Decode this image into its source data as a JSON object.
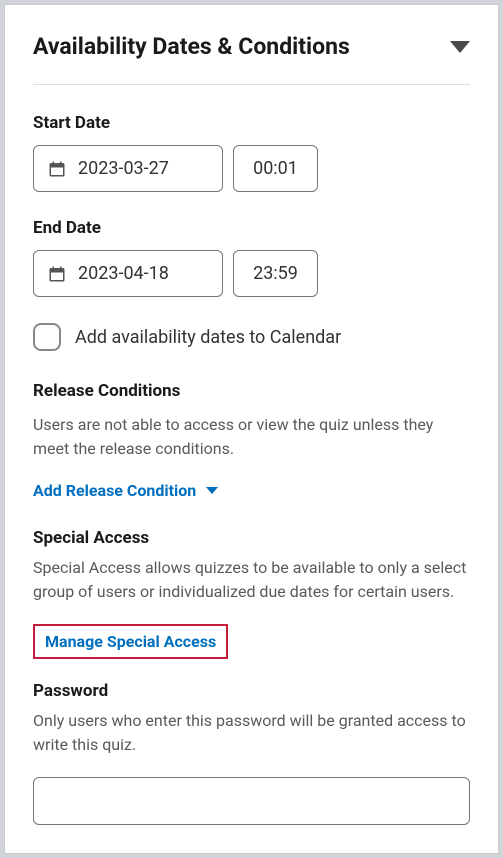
{
  "panel": {
    "title": "Availability Dates & Conditions"
  },
  "startDate": {
    "label": "Start Date",
    "date": "2023-03-27",
    "time": "00:01"
  },
  "endDate": {
    "label": "End Date",
    "date": "2023-04-18",
    "time": "23:59"
  },
  "calendarCheckbox": {
    "label": "Add availability dates to Calendar",
    "checked": false
  },
  "releaseConditions": {
    "heading": "Release Conditions",
    "description": "Users are not able to access or view the quiz unless they meet the release conditions.",
    "action": "Add Release Condition"
  },
  "specialAccess": {
    "heading": "Special Access",
    "description": "Special Access allows quizzes to be available to only a select group of users or individualized due dates for certain users.",
    "action": "Manage Special Access"
  },
  "password": {
    "heading": "Password",
    "description": "Only users who enter this password will be granted access to write this quiz.",
    "value": ""
  }
}
